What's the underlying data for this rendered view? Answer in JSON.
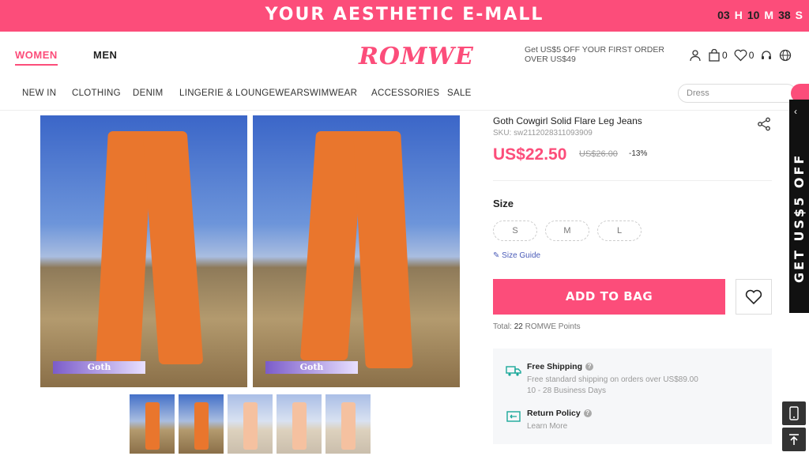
{
  "banner": {
    "title": "YOUR AESTHETIC E-MALL",
    "countdown": [
      {
        "num": "03",
        "unit": "H"
      },
      {
        "num": "10",
        "unit": "M"
      },
      {
        "num": "38",
        "unit": "S"
      }
    ]
  },
  "header": {
    "women": "WOMEN",
    "men": "MEN",
    "logo": "ROMWE",
    "promo": "Get US$5 OFF YOUR FIRST ORDER OVER US$49",
    "bag_count": "0",
    "wishlist_count": "0"
  },
  "nav": {
    "items": [
      "NEW IN",
      "CLOTHING",
      "DENIM",
      "LINGERIE & LOUNGEWEAR",
      "SWIMWEAR",
      "ACCESSORIES",
      "SALE"
    ],
    "search_placeholder": "Dress"
  },
  "gallery": {
    "tag": "Goth"
  },
  "product": {
    "name": "Goth Cowgirl Solid Flare Leg Jeans",
    "sku": "SKU: sw2112028311093909",
    "price": "US$22.50",
    "old_price": "US$26.00",
    "discount": "-13%",
    "size_label": "Size",
    "sizes": [
      "S",
      "M",
      "L"
    ],
    "size_guide": "Size Guide",
    "add_to_bag": "ADD TO BAG",
    "points_prefix": "Total:",
    "points_value": "22",
    "points_suffix": "ROMWE Points"
  },
  "shipping": {
    "free_title": "Free Shipping",
    "free_line1": "Free standard shipping on orders over US$89.00",
    "free_line2": "10 - 28 Business Days",
    "return_title": "Return Policy",
    "return_link": "Learn More"
  },
  "side_promo": {
    "text": "GET US$5 OFF"
  },
  "colors": {
    "brand": "#fc4d7a",
    "jeans": "#e9762d"
  }
}
